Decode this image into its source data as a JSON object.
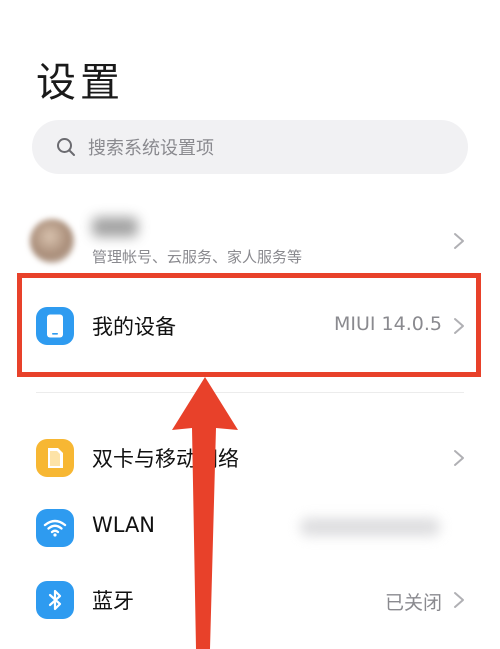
{
  "header": {
    "title": "设置"
  },
  "search": {
    "placeholder": "搜索系统设置项",
    "icon": "search-icon"
  },
  "account": {
    "subtitle": "管理帐号、云服务、家人服务等"
  },
  "my_device": {
    "label": "我的设备",
    "value": "MIUI 14.0.5",
    "icon_color": "#2e9bf0"
  },
  "settings": [
    {
      "key": "sim",
      "label": "双卡与移动网络",
      "value": "",
      "icon": "sim-card-icon",
      "icon_color": "#f7b733"
    },
    {
      "key": "wlan",
      "label": "WLAN",
      "value": "",
      "icon": "wifi-icon",
      "icon_color": "#2e9bf0"
    },
    {
      "key": "bluetooth",
      "label": "蓝牙",
      "value": "已关闭",
      "icon": "bluetooth-icon",
      "icon_color": "#2e9bf0"
    }
  ],
  "annotation": {
    "color": "#e8412a"
  }
}
